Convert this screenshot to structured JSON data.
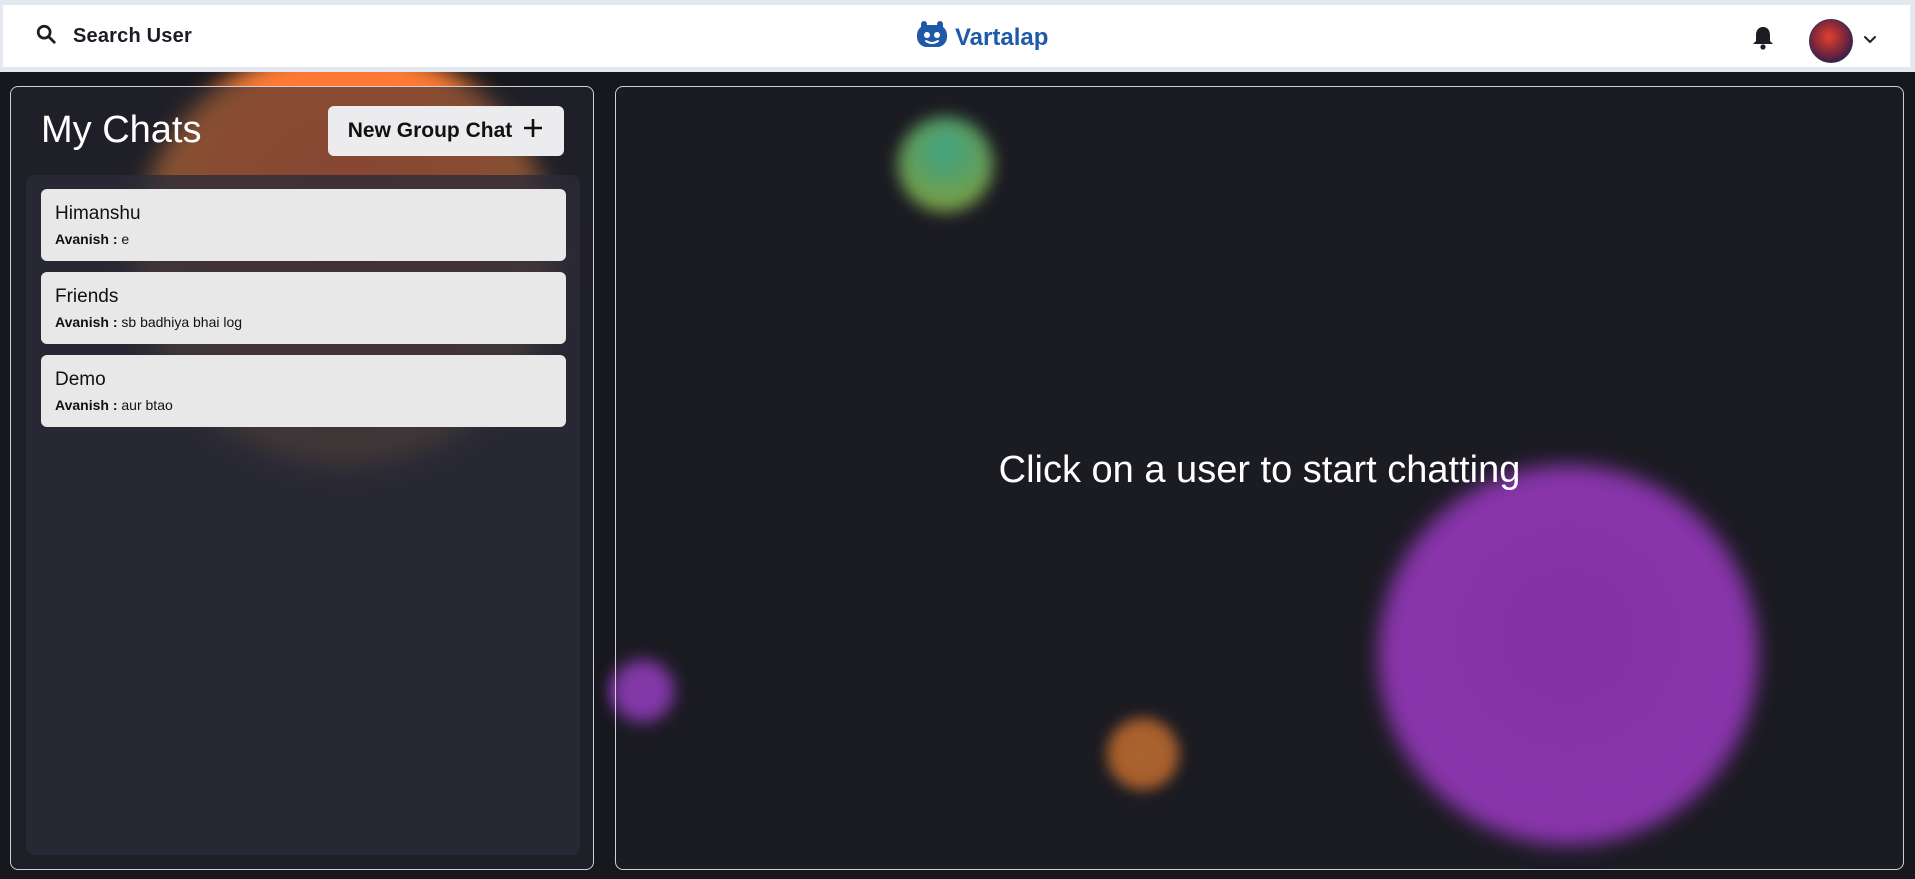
{
  "header": {
    "search_label": "Search User",
    "logo_text": "Vartalap"
  },
  "sidebar": {
    "title": "My Chats",
    "new_group_label": "New Group Chat",
    "chats": [
      {
        "name": "Himanshu",
        "sender": "Avanish :",
        "message": "e"
      },
      {
        "name": "Friends",
        "sender": "Avanish :",
        "message": "sb badhiya bhai log"
      },
      {
        "name": "Demo",
        "sender": "Avanish :",
        "message": "aur btao"
      }
    ]
  },
  "main": {
    "placeholder": "Click on a user to start chatting"
  },
  "colors": {
    "logo": "#1f5aa8",
    "background": "#17171e",
    "chat_item": "#e8e8e8"
  }
}
